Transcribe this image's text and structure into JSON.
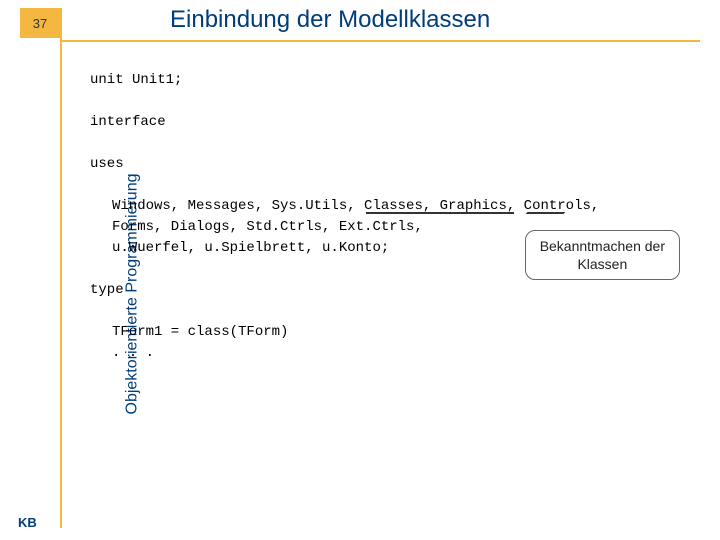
{
  "page_number": "37",
  "title": "Einbindung der Modellklassen",
  "sidebar_label": "Objektorientierte Programmierung",
  "footer_label": "KB",
  "code": {
    "l1": "unit Unit1;",
    "l2": "interface",
    "l3": "uses",
    "l4": "Windows, Messages, Sys.Utils, Classes, Graphics, Controls,",
    "l5": "Forms, Dialogs, Std.Ctrls, Ext.Ctrls,",
    "l6": "u.Wuerfel, u.Spielbrett, u.Konto;",
    "l7": "type",
    "l8": "TForm1 = class(TForm)",
    "l9": ". . ."
  },
  "callout": {
    "line1": "Bekanntmachen der",
    "line2": "Klassen"
  }
}
